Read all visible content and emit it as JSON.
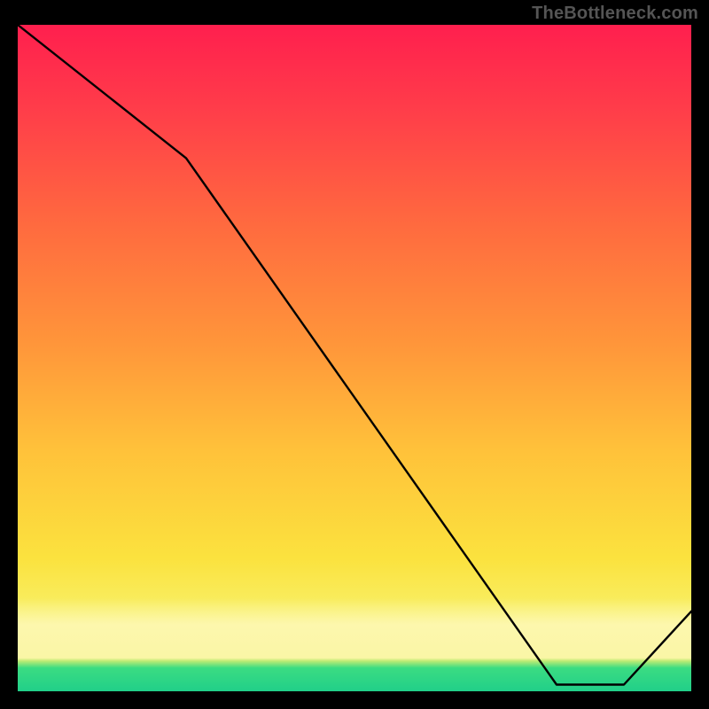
{
  "watermark": "TheBottleneck.com",
  "chart_data": {
    "type": "line",
    "x": [
      0,
      25,
      80,
      90,
      100
    ],
    "values": [
      100,
      80,
      1,
      1,
      12
    ],
    "title": "",
    "xlabel": "",
    "ylabel": "",
    "xlim": [
      0,
      100
    ],
    "ylim": [
      0,
      100
    ],
    "grid": false,
    "legend": false
  },
  "label_near_minimum": "",
  "colors": {
    "line": "#000000",
    "watermark": "#555555",
    "label": "#b52b2b",
    "gradient_top": "#ff1f4e",
    "gradient_mid": "#ffc23a",
    "gradient_low": "#f7f26e",
    "green_band": "#21cf89"
  }
}
